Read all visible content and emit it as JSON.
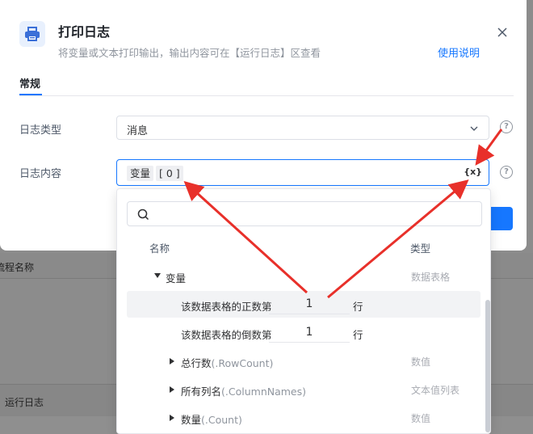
{
  "background": {
    "column_header": "流程名称",
    "log_panel_title": "运行日志"
  },
  "dialog": {
    "title": "打印日志",
    "subtitle": "将变量或文本打印输出，输出内容可在【运行日志】区查看",
    "help_link": "使用说明",
    "tab": "常规",
    "log_type_label": "日志类型",
    "log_type_value": "消息",
    "log_content_label": "日志内容",
    "content_chip_var": "变量",
    "content_chip_index": "[ 0 ]",
    "var_button": "{x}"
  },
  "dropdown": {
    "col_name": "名称",
    "col_type": "类型",
    "rows": [
      {
        "name": "变量",
        "prop": "",
        "type": "数据表格"
      },
      {
        "name": "该数据表格的正数第",
        "value": "1",
        "unit": "行"
      },
      {
        "name": "该数据表格的倒数第",
        "value": "1",
        "unit": "行"
      },
      {
        "name": "总行数",
        "prop": "(.RowCount)",
        "type": "数值"
      },
      {
        "name": "所有列名",
        "prop": "(.ColumnNames)",
        "type": "文本值列表"
      },
      {
        "name": "数量",
        "prop": "(.Count)",
        "type": "数值"
      }
    ]
  },
  "colors": {
    "accent": "#1677ff",
    "annotation_arrow": "#e8302a"
  }
}
